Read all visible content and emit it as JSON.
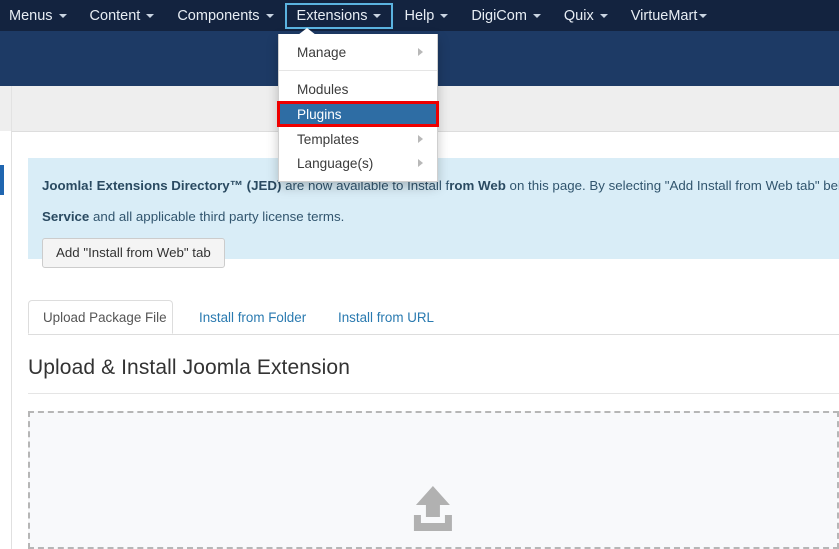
{
  "topbar": {
    "menu_items": [
      {
        "label": "Menus",
        "has_caret": true,
        "active": false
      },
      {
        "label": "Content",
        "has_caret": true,
        "active": false
      },
      {
        "label": "Components",
        "has_caret": true,
        "active": false
      },
      {
        "label": "Extensions",
        "has_caret": true,
        "active": true
      },
      {
        "label": "Help",
        "has_caret": true,
        "active": false
      },
      {
        "label": "DigiCom",
        "has_caret": true,
        "active": false
      },
      {
        "label": "Quix",
        "has_caret": true,
        "active": false
      },
      {
        "label": "VirtueMart",
        "has_caret": true,
        "active": false
      }
    ]
  },
  "extensions_dropdown": {
    "items": [
      {
        "label": "Manage",
        "submenu": true,
        "highlighted": false
      },
      {
        "label": "Modules",
        "submenu": false,
        "highlighted": false
      },
      {
        "label": "Plugins",
        "submenu": false,
        "highlighted": true
      },
      {
        "label": "Templates",
        "submenu": true,
        "highlighted": false
      },
      {
        "label": "Language(s)",
        "submenu": true,
        "highlighted": false
      }
    ]
  },
  "alert": {
    "line1_part1": "Joomla! Extensions Directory™ (JED)",
    "line1_part2": " are now available to Install f",
    "line1_part3": "rom Web",
    "line1_part4": " on this page. By selecting \"Add Install from Web tab\" below,",
    "line2_bold": "Service",
    "line2_rest": " and all applicable third party license terms.",
    "button_label": "Add \"Install from Web\" tab"
  },
  "tabs": [
    {
      "label": "Upload Package File",
      "active": true
    },
    {
      "label": "Install from Folder",
      "active": false
    },
    {
      "label": "Install from URL",
      "active": false
    }
  ],
  "heading": "Upload & Install Joomla Extension",
  "dropzone": {
    "icon": "upload-tray-icon"
  },
  "colors": {
    "topbar_bg": "#13233f",
    "subbar_bg": "#1d3a65",
    "graybar_bg": "#eeeeee",
    "alert_bg": "#d9edf7",
    "highlight_blue": "#2e6da4",
    "highlight_outline_red": "#ee0000",
    "active_menu_outline": "#5bb3e0",
    "tab_link": "#2a7ab0",
    "sidebar_marker": "#2066b0",
    "dropzone_bg": "#f8f9fb",
    "upload_icon": "#b1b1b1"
  }
}
